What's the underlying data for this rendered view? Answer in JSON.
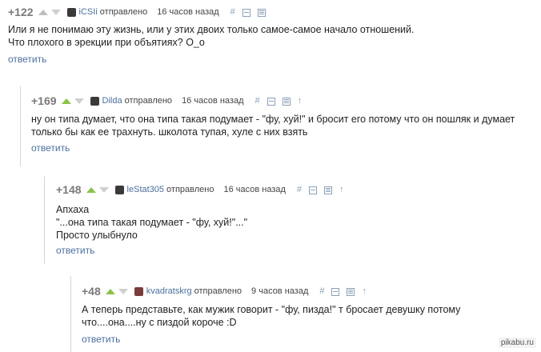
{
  "comments": [
    {
      "rating": "+122",
      "username": "iCSIi",
      "sent": "отправлено",
      "time": "16 часов назад",
      "lines": [
        "Или я не понимаю эту жизнь, или у этих двоих только самое-самое начало отношений.",
        "Что плохого в эрекции при объятиях? О_о"
      ],
      "reply": "ответить"
    },
    {
      "rating": "+169",
      "username": "Dilda",
      "sent": "отправлено",
      "time": "16 часов назад",
      "lines": [
        "ну он типа думает, что она типа такая подумает - \"фу, хуй!\" и бросит его потому что он пошляк и думает",
        "только бы как ее трахнуть. школота тупая, хуле с них взять"
      ],
      "reply": "ответить"
    },
    {
      "rating": "+148",
      "username": "leStat305",
      "sent": "отправлено",
      "time": "16 часов назад",
      "lines": [
        "Апхаха",
        "\"...она типа такая подумает - \"фу, хуй!\"...\"",
        "Просто улыбнуло"
      ],
      "reply": "ответить"
    },
    {
      "rating": "+48",
      "username": "kvadratskrg",
      "sent": "отправлено",
      "time": "9 часов назад",
      "lines": [
        "А теперь представьте, как мужик говорит - \"фу, пизда!\" т бросает девушку потому",
        "что....она....ну с пиздой короче :D"
      ],
      "reply": "ответить"
    }
  ],
  "tools": {
    "link": "#",
    "up": "↑"
  },
  "watermark": "pikabu.ru",
  "colors": {
    "link": "#4a6f9e",
    "upvote_active": "#8bc34a",
    "upvote_inactive": "#bfbfbf"
  }
}
